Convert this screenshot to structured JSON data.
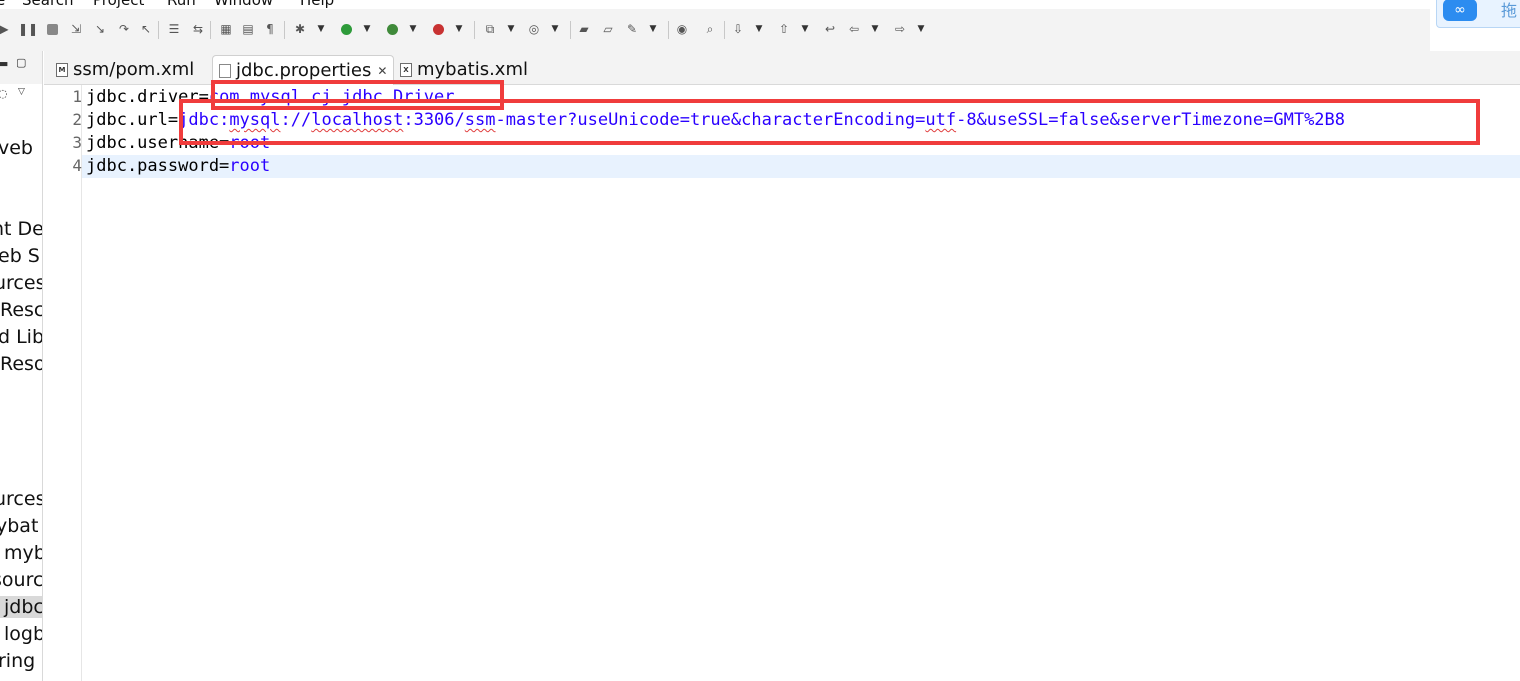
{
  "menu": {
    "items": [
      "e",
      "Search",
      "Project",
      "Run",
      "Window",
      "Help"
    ]
  },
  "widget": {
    "label": "拖"
  },
  "explorer": {
    "items": [
      "veb",
      "nt De",
      "eb S",
      "urces",
      "Resc",
      "d Lib",
      "Reso",
      "urces",
      "ybat",
      "myb",
      "sourc",
      "jdbc",
      "logb",
      "ring"
    ]
  },
  "tabs": [
    {
      "label": "ssm/pom.xml",
      "icon": "maven-xml-file-icon",
      "icon_glyph": "M"
    },
    {
      "label": "jdbc.properties",
      "icon": "properties-file-icon",
      "icon_glyph": "",
      "active": true,
      "close": "✕"
    },
    {
      "label": "mybatis.xml",
      "icon": "xml-file-icon",
      "icon_glyph": "X"
    }
  ],
  "editor": {
    "lines": [
      {
        "num": "1",
        "key": "jdbc.driver=",
        "value": "com.mysql.cj.jdbc.Driver"
      },
      {
        "num": "2",
        "key": "jdbc.url=",
        "value_parts": [
          "jdbc:",
          "mysql",
          "://",
          "localhost",
          ":3306/",
          "ssm",
          "-master?useUnicode=true&characterEncoding=",
          "utf",
          "-8&useSSL=false&serverTimezone=GMT%2B8"
        ]
      },
      {
        "num": "3",
        "key": "jdbc.username=",
        "value": "root"
      },
      {
        "num": "4",
        "key": "jdbc.password=",
        "value": "root"
      }
    ]
  },
  "colors": {
    "key": "#000000",
    "value": "#2a00ff",
    "annotation": "#f03c3c",
    "current_line": "#e8f2fe"
  }
}
